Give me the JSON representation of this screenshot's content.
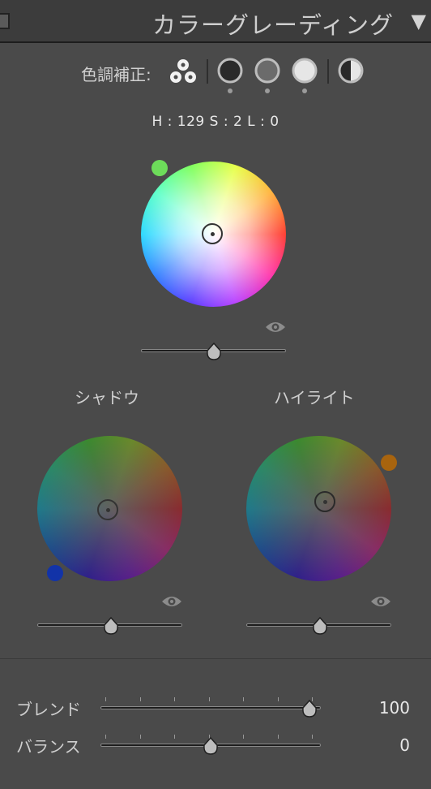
{
  "header": {
    "title": "カラーグレーディング",
    "collapse_icon": "triangle-down-icon"
  },
  "toolbar": {
    "label": "色調補正:",
    "buttons": [
      "three-way-icon",
      "shadows-icon",
      "midtones-icon",
      "highlights-icon",
      "global-icon"
    ]
  },
  "readout": {
    "text": "H : 129 S : 2 L : 0"
  },
  "midtones": {
    "label": "",
    "swatch_color": "#6ddc5a",
    "luminance_value": 0.5
  },
  "shadows": {
    "label": "シャドウ",
    "swatch_color": "#1233a8",
    "luminance_value": 0.5
  },
  "highlights": {
    "label": "ハイライト",
    "swatch_color": "#a8640e",
    "luminance_value": 0.5
  },
  "blend": {
    "label": "ブレンド",
    "value": "100",
    "position": 1.0
  },
  "balance": {
    "label": "バランス",
    "value": "0",
    "position": 0.5
  },
  "colors": {
    "panel_bg": "#4a4a4a",
    "header_bg": "#3c3c3c"
  }
}
